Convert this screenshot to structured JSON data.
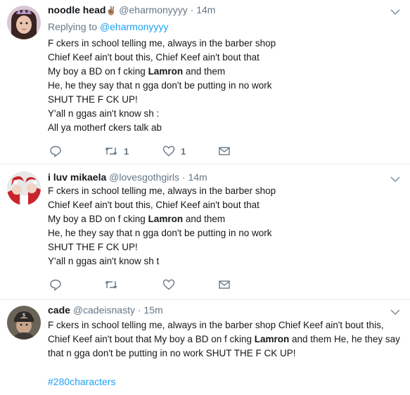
{
  "tweets": [
    {
      "display_name": "noodle head",
      "name_emoji": "✌🏽",
      "handle": "@eharmonyyyy",
      "time": "14m",
      "replying_prefix": "Replying to ",
      "replying_to": "@eharmonyyyy",
      "lines": [
        [
          "F  ckers in school telling me, always in the barber shop"
        ],
        [
          "Chief Keef ain't bout this, Chief Keef ain't bout that"
        ],
        [
          "My boy a BD on f  cking ",
          "Lamron",
          " and them"
        ],
        [
          "He, he they say that n  gga don't be putting in no work"
        ],
        [
          "SHUT THE F  CK UP!"
        ],
        [
          "Y'all n  ggas ain't know sh  :"
        ],
        [
          "All ya motherf  ckers talk ab"
        ]
      ],
      "reply_count": "",
      "retweet_count": "1",
      "like_count": "1"
    },
    {
      "display_name": "i luv mikaela",
      "handle": "@lovesgothgirls",
      "time": "14m",
      "lines": [
        [
          "F  ckers in school telling me, always in the barber shop"
        ],
        [
          "Chief Keef ain't bout this, Chief Keef ain't bout that"
        ],
        [
          "My boy a BD on f  cking ",
          "Lamron",
          " and them"
        ],
        [
          "He, he they say that n  gga don't be putting in no work"
        ],
        [
          "SHUT THE F  CK UP!"
        ],
        [
          "Y'all n  ggas ain't know sh  t"
        ]
      ]
    },
    {
      "display_name": "cade",
      "handle": "@cadeisnasty",
      "time": "15m",
      "paragraph": [
        "F  ckers in school telling me, always in the barber shop Chief Keef ain't bout this, Chief Keef ain't bout that My boy a BD on f  cking ",
        "Lamron",
        " and them He, he they say that n  gga don't be putting in no work SHUT THE F  CK UP!"
      ],
      "hashtag": "#280characters"
    }
  ],
  "separator_dot": "·",
  "icons": [
    "reply-icon",
    "retweet-icon",
    "like-icon",
    "message-icon",
    "chevron-down-icon"
  ],
  "colors": {
    "link": "#1da1f2",
    "muted": "#657786",
    "text": "#14171a",
    "border": "#e6ecf0"
  }
}
